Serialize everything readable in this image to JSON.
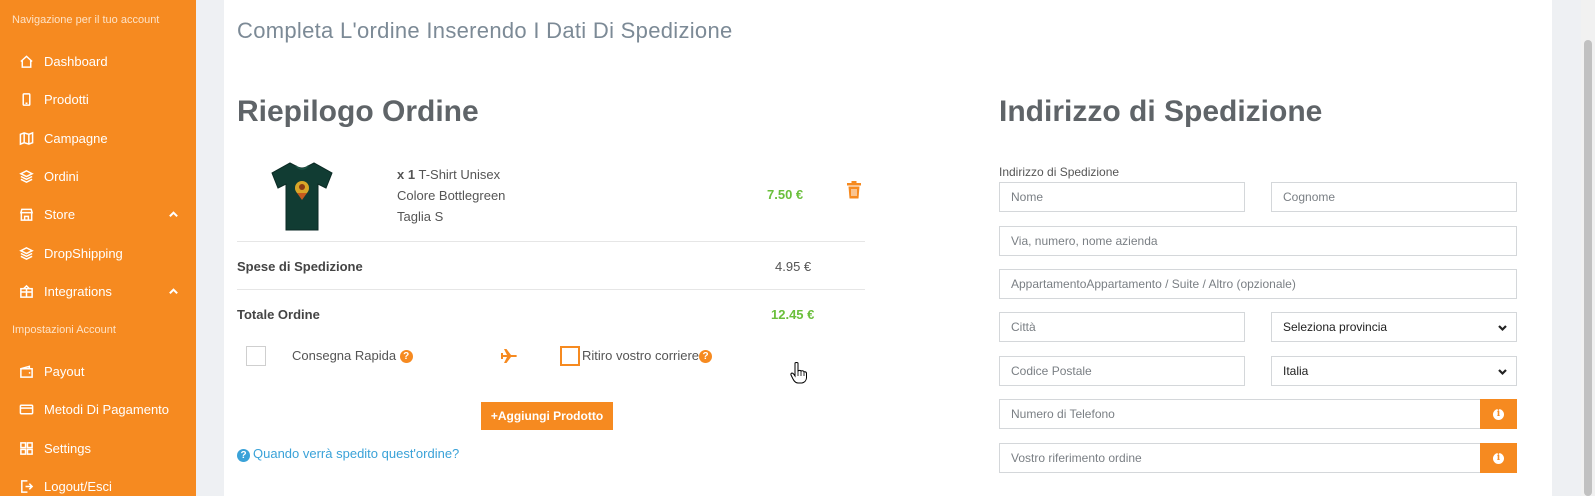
{
  "sidebar": {
    "section_nav": "Navigazione per il tuo account",
    "section_settings": "Impostazioni Account",
    "items": [
      {
        "label": "Dashboard",
        "icon": "home-icon"
      },
      {
        "label": "Prodotti",
        "icon": "phone-icon"
      },
      {
        "label": "Campagne",
        "icon": "map-icon"
      },
      {
        "label": "Ordini",
        "icon": "layers-icon"
      },
      {
        "label": "Store",
        "icon": "store-icon"
      },
      {
        "label": "DropShipping",
        "icon": "layers-icon"
      },
      {
        "label": "Integrations",
        "icon": "package-icon"
      },
      {
        "label": "Payout",
        "icon": "wallet-icon"
      },
      {
        "label": "Metodi Di Pagamento",
        "icon": "credit-card-icon"
      },
      {
        "label": "Settings",
        "icon": "grid-icon"
      },
      {
        "label": "Logout/Esci",
        "icon": "logout-icon"
      }
    ],
    "accent_color": "#f68a20"
  },
  "page": {
    "title": "Completa L'ordine Inserendo I Dati Di Spedizione"
  },
  "summary": {
    "heading": "Riepilogo Ordine",
    "product": {
      "qty": "x 1",
      "name": "T-Shirt Unisex",
      "color": "Colore Bottlegreen",
      "size": "Taglia S",
      "price": "7.50 €"
    },
    "shipping_label": "Spese di Spedizione",
    "shipping_value": "4.95 €",
    "total_label": "Totale Ordine",
    "total_value": "12.45 €",
    "express_label": "Consegna Rapida",
    "pickup_label": "Ritiro vostro corriere",
    "help_glyph": "?",
    "add_button": "Aggiungi Prodotto",
    "add_glyph": "+",
    "when_link": "Quando verrà spedito quest'ordine?"
  },
  "address": {
    "heading": "Indirizzo di Spedizione",
    "label": "Indirizzo di Spedizione",
    "placeholders": {
      "name": "Nome",
      "surname": "Cognome",
      "street": "Via, numero, nome azienda",
      "apartment": "AppartamentoAppartamento / Suite / Altro (opzionale)",
      "city": "Città",
      "postal": "Codice Postale",
      "phone": "Numero di Telefono",
      "reference": "Vostro riferimento ordine"
    },
    "province_select": "Seleziona provincia",
    "country_select": "Italia",
    "info_glyph": "i"
  }
}
